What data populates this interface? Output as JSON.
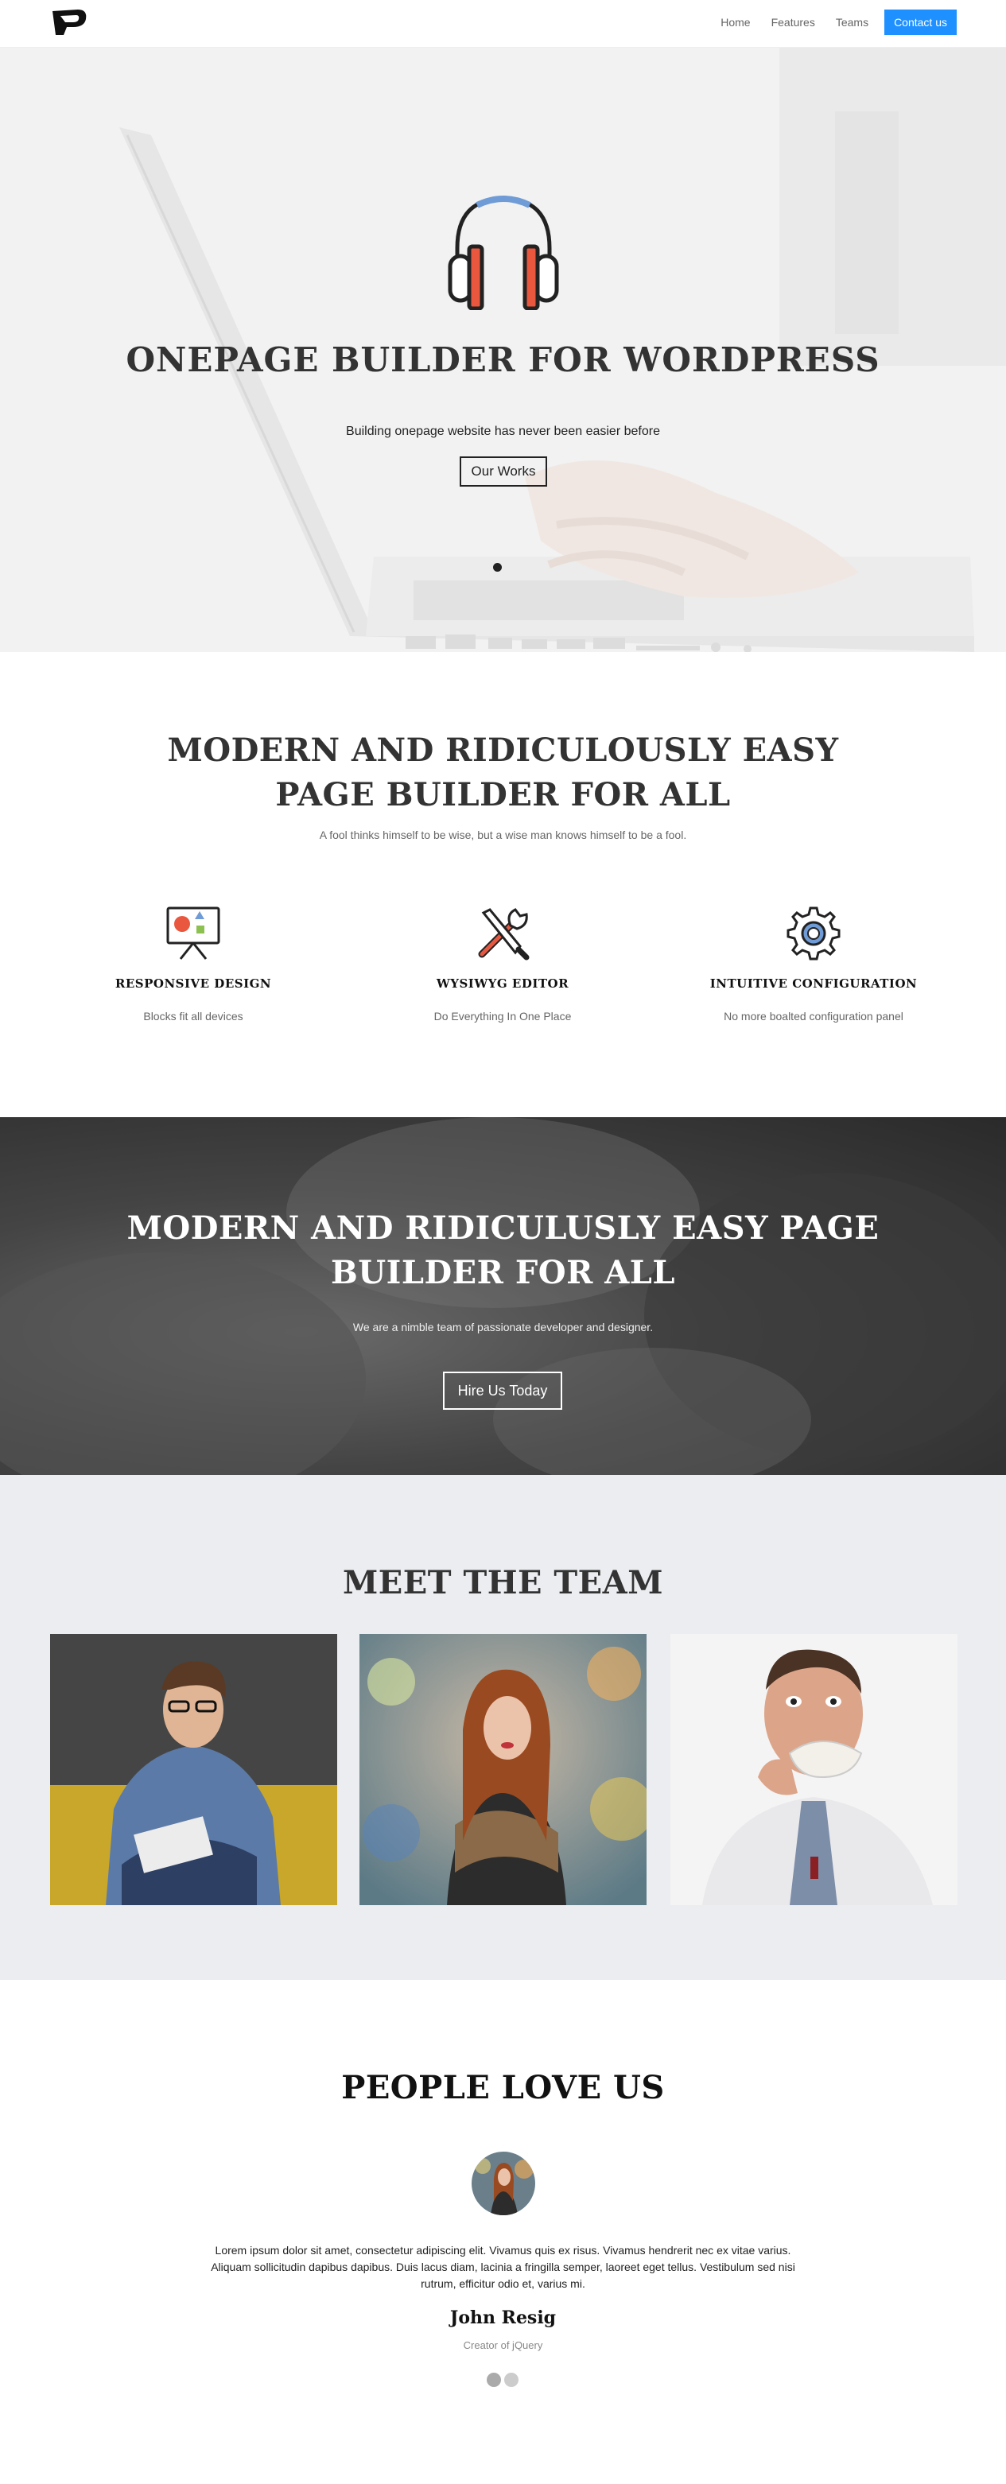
{
  "nav": {
    "logo_alt": "P",
    "items": [
      {
        "label": "Home"
      },
      {
        "label": "Features"
      },
      {
        "label": "Teams"
      }
    ],
    "cta_label": "Contact us",
    "cta_color": "#1e90ff"
  },
  "hero": {
    "icon": "headphones-icon",
    "title": "ONEPAGE BUILDER FOR WORDPRESS",
    "subtitle": "Building onepage website has never been easier before",
    "button_label": "Our Works",
    "slide_count": 1
  },
  "features": {
    "title_line1": "MODERN AND RIDICULOUSLY EASY",
    "title_line2": "PAGE BUILDER FOR ALL",
    "subtitle": "A fool thinks himself to be wise, but a wise man knows himself to be a fool.",
    "items": [
      {
        "icon": "presentation-board-icon",
        "title": "RESPONSIVE DESIGN",
        "text": "Blocks fit all devices"
      },
      {
        "icon": "tools-icon",
        "title": "WYSIWYG EDITOR",
        "text": "Do Everything In One Place"
      },
      {
        "icon": "gear-icon",
        "title": "INTUITIVE CONFIGURATION",
        "text": "No more boalted configuration panel"
      }
    ]
  },
  "banner": {
    "title": "MODERN AND RIDICULUSLY EASY PAGE BUILDER FOR ALL",
    "subtitle": "We are a nimble team of passionate developer and designer.",
    "button_label": "Hire Us Today"
  },
  "team": {
    "title": "MEET THE TEAM"
  },
  "testimonials": {
    "title": "PEOPLE LOVE US",
    "quote": "Lorem ipsum dolor sit amet, consectetur adipiscing elit. Vivamus quis ex risus. Vivamus hendrerit nec ex vitae varius. Aliquam sollicitudin dapibus dapibus. Duis lacus diam, lacinia a fringilla semper, laoreet eget tellus. Vestibulum sed nisi rutrum, efficitur odio et, varius mi.",
    "name": "John Resig",
    "role": "Creator of jQuery",
    "page_count": 2,
    "active_page": 1
  }
}
